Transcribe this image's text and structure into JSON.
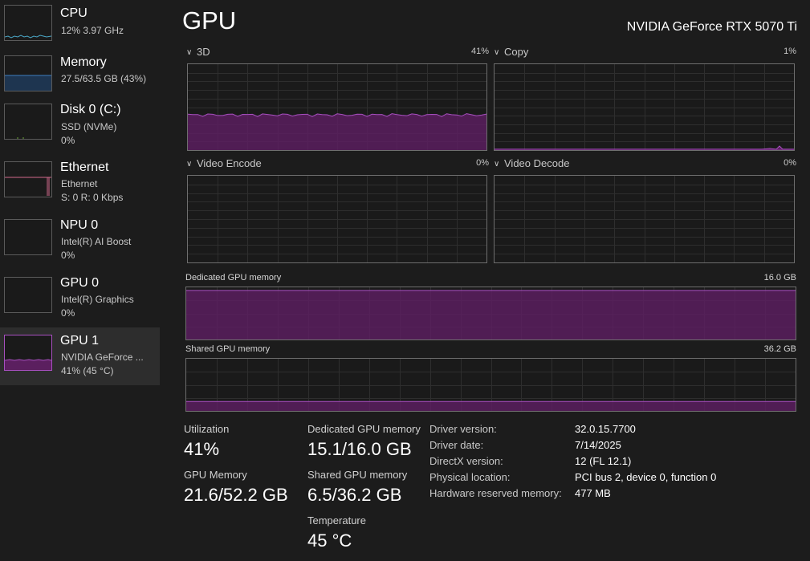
{
  "sidebar": {
    "items": [
      {
        "title": "CPU",
        "sub1": "12%  3.97 GHz",
        "sub2": "",
        "color": "#4aa7c6",
        "selected": false
      },
      {
        "title": "Memory",
        "sub1": "27.5/63.5 GB (43%)",
        "sub2": "",
        "color": "#3f7fc0",
        "selected": false
      },
      {
        "title": "Disk 0 (C:)",
        "sub1": "SSD (NVMe)",
        "sub2": "0%",
        "color": "#6fa83a",
        "selected": false
      },
      {
        "title": "Ethernet",
        "sub1": "Ethernet",
        "sub2": "S: 0  R: 0 Kbps",
        "color": "#d26a8c",
        "selected": false
      },
      {
        "title": "NPU 0",
        "sub1": "Intel(R) AI Boost",
        "sub2": "0%",
        "color": "#4aa7c6",
        "selected": false
      },
      {
        "title": "GPU 0",
        "sub1": "Intel(R) Graphics",
        "sub2": "0%",
        "color": "#a84fc0",
        "selected": false
      },
      {
        "title": "GPU 1",
        "sub1": "NVIDIA GeForce ...",
        "sub2": "41% (45 °C)",
        "color": "#a84fc0",
        "selected": true
      }
    ]
  },
  "header": {
    "title": "GPU",
    "device_name": "NVIDIA GeForce RTX 5070 Ti"
  },
  "graphs": {
    "engine_3d": {
      "label": "3D",
      "value": "41%",
      "level": 0.41
    },
    "copy": {
      "label": "Copy",
      "value": "1%",
      "level": 0.01
    },
    "video_encode": {
      "label": "Video Encode",
      "value": "0%",
      "level": 0
    },
    "video_decode": {
      "label": "Video Decode",
      "value": "0%",
      "level": 0
    },
    "dedicated_memory": {
      "label": "Dedicated GPU memory",
      "max": "16.0 GB",
      "level": 0.94
    },
    "shared_memory": {
      "label": "Shared GPU memory",
      "max": "36.2 GB",
      "level": 0.18
    }
  },
  "stats": {
    "utilization_label": "Utilization",
    "utilization_value": "41%",
    "gpu_memory_label": "GPU Memory",
    "gpu_memory_value": "21.6/52.2 GB",
    "dedicated_label": "Dedicated GPU memory",
    "dedicated_value": "15.1/16.0 GB",
    "shared_label": "Shared GPU memory",
    "shared_value": "6.5/36.2 GB",
    "temperature_label": "Temperature",
    "temperature_value": "45 °C"
  },
  "info": [
    {
      "label": "Driver version:",
      "value": "32.0.15.7700"
    },
    {
      "label": "Driver date:",
      "value": "7/14/2025"
    },
    {
      "label": "DirectX version:",
      "value": "12 (FL 12.1)"
    },
    {
      "label": "Physical location:",
      "value": "PCI bus 2, device 0, function 0"
    },
    {
      "label": "Hardware reserved memory:",
      "value": "477 MB"
    }
  ],
  "colors": {
    "accent": "#a84fc0",
    "graph_fill": "#5b1f5f",
    "background": "#1c1c1c",
    "selected_bg": "#2d2d2d"
  }
}
